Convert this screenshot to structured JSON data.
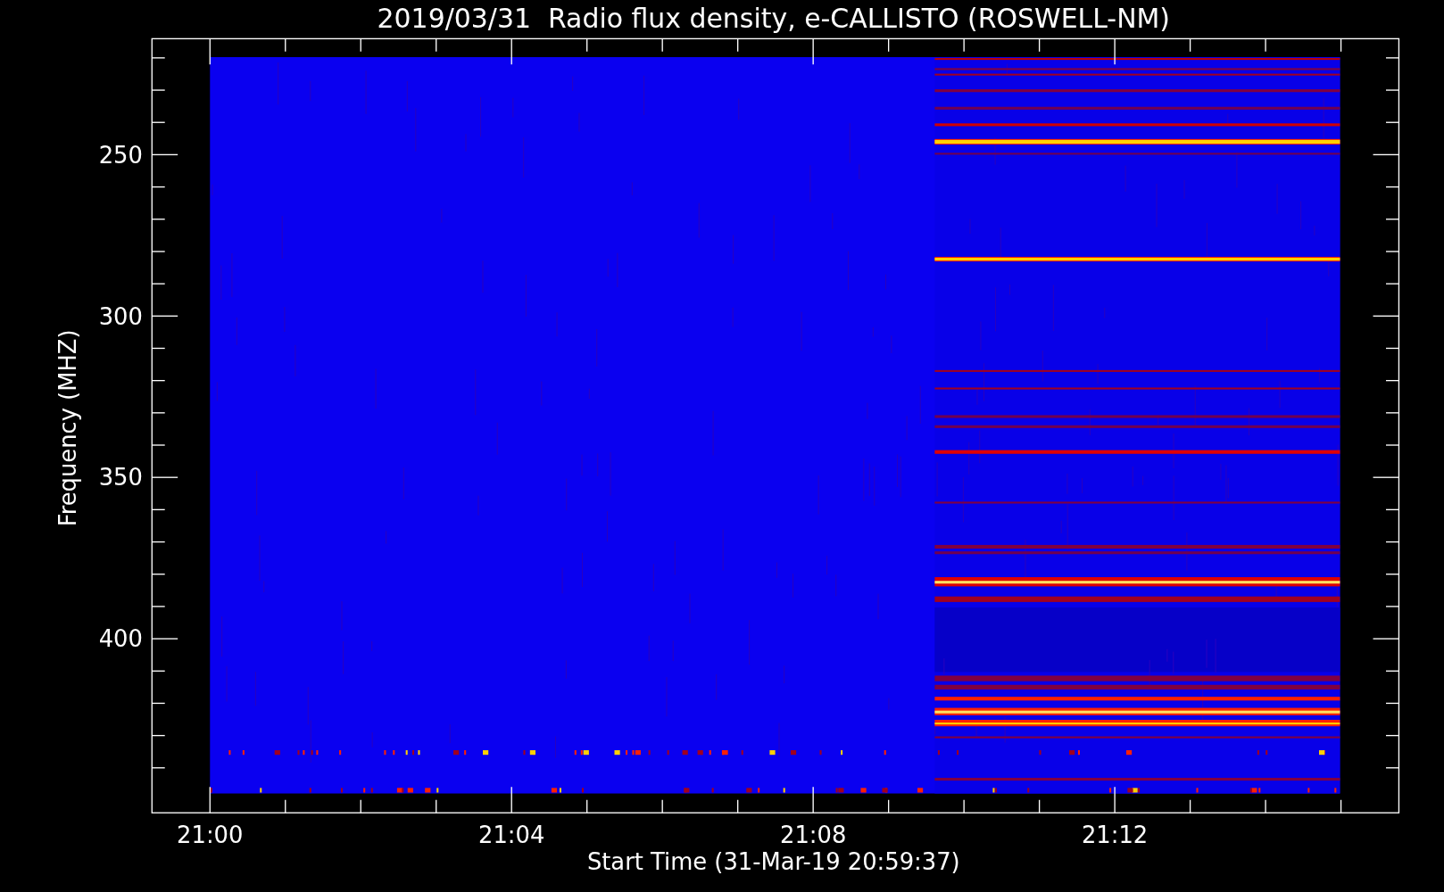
{
  "title": "2019/03/31  Radio flux density, e-CALLISTO (ROSWELL-NM)",
  "y_axis": {
    "label": "Frequency (MHZ)",
    "ticks": [
      "250",
      "300",
      "350",
      "400"
    ]
  },
  "x_axis": {
    "label": "Start Time (31-Mar-19 20:59:37)",
    "ticks": [
      "21:00",
      "21:04",
      "21:08",
      "21:12"
    ]
  }
}
